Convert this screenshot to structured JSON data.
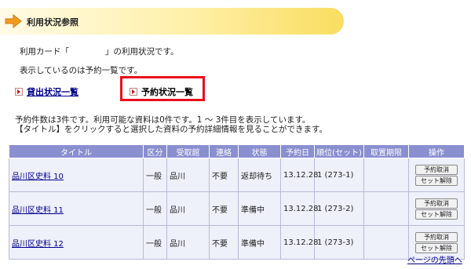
{
  "header": {
    "title": "利用状況参照",
    "icon": "arrow-right-icon"
  },
  "intro": {
    "card_prefix": "利用カード「",
    "card_suffix": "」の利用状況です。",
    "showing": "表示しているのは予約一覧です。"
  },
  "tabs": [
    {
      "label": "貸出状況一覧",
      "active": false
    },
    {
      "label": "予約状況一覧",
      "active": true
    }
  ],
  "info": {
    "line1": "予約件数は3件です。利用可能な資料は0件です。1 ～ 3件目を表示しています。",
    "line2": "【タイトル】をクリックすると選択した資料の予約詳細情報を見ることができます。"
  },
  "table": {
    "headers": [
      "タイトル",
      "区分",
      "受取館",
      "連絡",
      "状態",
      "予約日",
      "順位(セット)",
      "取置期限",
      "操作"
    ],
    "rows": [
      {
        "title": "品川区史料 10",
        "kubun": "一般",
        "kan": "品川",
        "renraku": "不要",
        "jotai": "返却待ち",
        "date": "13.12.28",
        "rank": "1 (273-1)",
        "limit": "",
        "btn1": "予約取消",
        "btn2": "セット解除"
      },
      {
        "title": "品川区史料 11",
        "kubun": "一般",
        "kan": "品川",
        "renraku": "不要",
        "jotai": "準備中",
        "date": "13.12.28",
        "rank": "1 (273-2)",
        "limit": "",
        "btn1": "予約取消",
        "btn2": "セット解除"
      },
      {
        "title": "品川区史料 12",
        "kubun": "一般",
        "kan": "品川",
        "renraku": "不要",
        "jotai": "準備中",
        "date": "13.12.28",
        "rank": "1 (273-3)",
        "limit": "",
        "btn1": "予約取消",
        "btn2": "セット解除"
      }
    ]
  },
  "footer": {
    "page_top": "ページの先頭へ"
  },
  "colors": {
    "table_header": "#8a8fd0",
    "highlight_border": "#e8101a",
    "link": "#00008b",
    "arrow": "#f39a1e"
  }
}
